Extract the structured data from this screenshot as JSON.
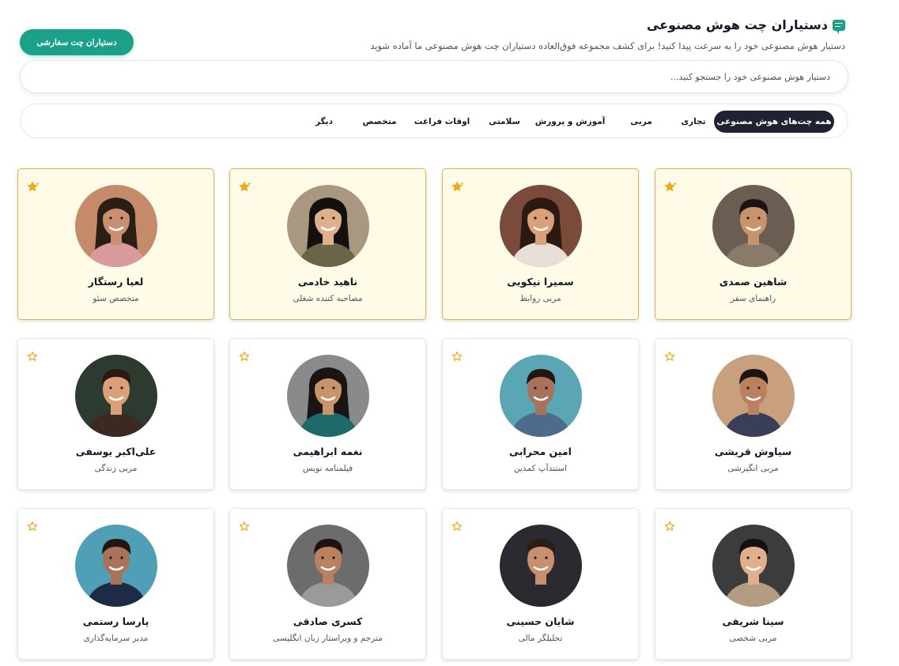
{
  "header": {
    "title": "دستیاران چت هوش مصنوعی",
    "subtitle": "دستیار هوش مصنوعی خود را به سرعت پیدا کنید! برای کشف مجموعه فوق‌العاده دستیاران چت هوش مصنوعی ما آماده شوید",
    "custom_button": "دستیاران چت سفارشی",
    "icon": "chat-icon"
  },
  "search": {
    "placeholder": "دستیار هوش مصنوعی خود را جستجو کنید..."
  },
  "tabs": [
    {
      "label": "همه چت‌های هوش مصنوعی",
      "active": true
    },
    {
      "label": "تجاری"
    },
    {
      "label": "مربی"
    },
    {
      "label": "آموزش و پرورش"
    },
    {
      "label": "سلامتی"
    },
    {
      "label": "اوقات فراغت"
    },
    {
      "label": "متخصص"
    },
    {
      "label": "دیگر"
    }
  ],
  "colors": {
    "accent": "#1aa187",
    "tab_active_bg": "#1f2233",
    "featured_bg": "#fffbe6",
    "featured_border": "#e6b14a",
    "star": "#f0a91a"
  },
  "cards": [
    {
      "name": "شاهین صمدی",
      "role": "راهنمای سفر",
      "featured": true
    },
    {
      "name": "سمیرا نیکویی",
      "role": "مربی روابط",
      "featured": true
    },
    {
      "name": "ناهید خادمی",
      "role": "مصاحبه کننده شغلی",
      "featured": true
    },
    {
      "name": "لعیا رستگار",
      "role": "متخصص سئو",
      "featured": true
    },
    {
      "name": "سیاوش قریشی",
      "role": "مربی انگیزشی",
      "featured": false
    },
    {
      "name": "امین محرابی",
      "role": "استندآپ کمدین",
      "featured": false
    },
    {
      "name": "نغمه ابراهیمی",
      "role": "فیلمنامه نویس",
      "featured": false
    },
    {
      "name": "علی‌اکبر یوسفی",
      "role": "مربی زندگی",
      "featured": false
    },
    {
      "name": "سینا شریفی",
      "role": "مربی شخصی",
      "featured": false
    },
    {
      "name": "شایان حسینی",
      "role": "تحلیلگر مالی",
      "featured": false
    },
    {
      "name": "کسری صادقی",
      "role": "مترجم و ویراستار زبان انگلیسی",
      "featured": false
    },
    {
      "name": "پارسا رستمی",
      "role": "مدیر سرمایه‌گذاری",
      "featured": false
    }
  ]
}
